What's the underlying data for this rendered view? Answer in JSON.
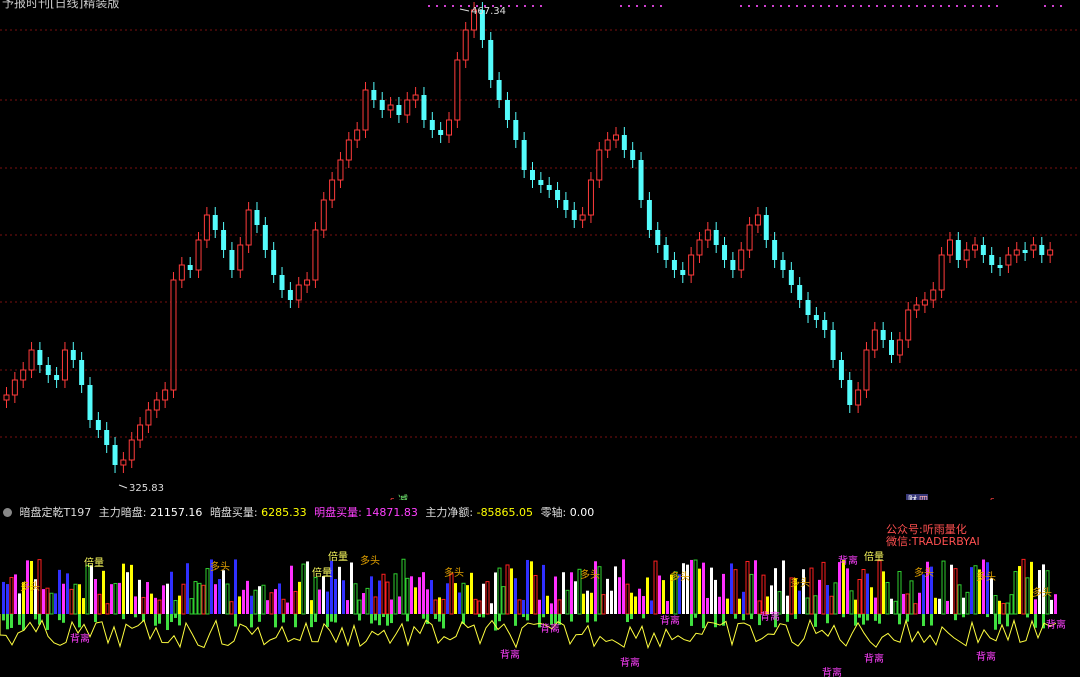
{
  "header": {
    "title": "予报时刊[日线]精装版"
  },
  "price_chart": {
    "high_label": "467.34",
    "low_label": "325.83",
    "candle_up_color": "#ff3b3b",
    "candle_down_color": "#54fcfc",
    "grid_color": "#7a1010"
  },
  "markers": {
    "jian": "减",
    "cai": "财",
    "cai2": "四",
    "s1": "s",
    "s2": "s"
  },
  "indicator": {
    "name": "暗盘定乾T197",
    "main_dark_label": "主力暗盘:",
    "main_dark_value": "21157.16",
    "dark_buy_label": "暗盘买量:",
    "dark_buy_value": "6285.33",
    "open_buy_label": "明盘买量:",
    "open_buy_value": "14871.83",
    "net_label": "主力净额:",
    "net_value": "-85865.05",
    "zero_label": "零轴:",
    "zero_value": "0.00",
    "colors": {
      "dark": "#ffffff",
      "dark_buy": "#ffff00",
      "open_buy": "#ff40ff",
      "net": "#ffff00"
    }
  },
  "promo": {
    "line1": "公众号:听雨量化",
    "line2": "微信:TRADERBYAI"
  },
  "tags": {
    "beiliang": "倍量",
    "duotou": "多头",
    "beili": "背离"
  }
}
